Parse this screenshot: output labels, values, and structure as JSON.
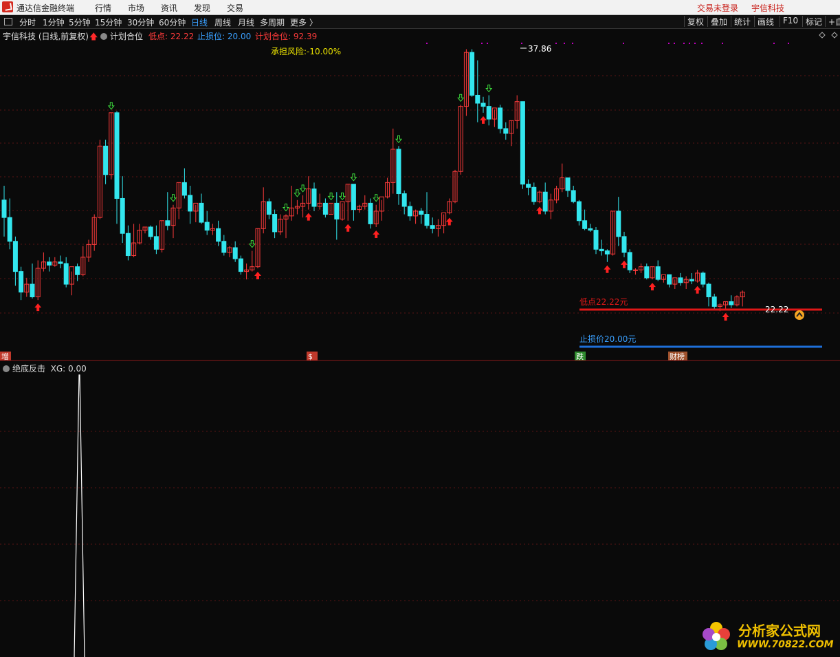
{
  "menubar": {
    "app_title": "通达信金融终端",
    "items": [
      "行情",
      "市场",
      "资讯",
      "发现",
      "交易"
    ],
    "login": "交易未登录",
    "stock_name": "宇信科技"
  },
  "toolbar": {
    "periods": [
      "分时",
      "1分钟",
      "5分钟",
      "15分钟",
      "30分钟",
      "60分钟",
      "日线",
      "周线",
      "月线",
      "多周期",
      "更多 〉"
    ],
    "active_period": "日线",
    "right_buttons": [
      "复权",
      "叠加",
      "统计",
      "画线",
      "F10",
      "标记",
      "+自"
    ]
  },
  "main_info": {
    "stock_title": "宇信科技 (日线,前复权)",
    "indicator": "计划合位",
    "low_point": "低点: 22.22",
    "stop_loss": "止损位: 20.00",
    "plan_position": "计划合位: 92.39",
    "risk": "承担风险:-10.00%"
  },
  "annotations": {
    "high_price": "37.86",
    "low_line_label": "低点22.22元",
    "low_value": "22.22",
    "stop_line_label": "止损价20.00元",
    "bottom_tags": [
      "增",
      "$",
      "跌",
      "财榜"
    ]
  },
  "sub_panel": {
    "title": "绝底反击",
    "value": "XG: 0.00"
  },
  "watermark": {
    "name": "分析家公式网",
    "url": "WWW.70822.COM"
  },
  "colors": {
    "up": "#ff3b3b",
    "down": "#33e6ee",
    "red_line": "#e01818",
    "blue_line": "#1e6fd8",
    "accent_blue": "#3aa0ff",
    "yellow": "#e8e000"
  },
  "chart_data": {
    "type": "candlestick",
    "price_range": [
      19.0,
      38.5
    ],
    "ohlc": [
      [
        28.5,
        29.4,
        26.2,
        27.4
      ],
      [
        27.4,
        28.6,
        25.4,
        25.9
      ],
      [
        25.9,
        26.2,
        23.1,
        24.0
      ],
      [
        24.0,
        24.3,
        22.2,
        22.7
      ],
      [
        22.7,
        23.6,
        22.4,
        23.2
      ],
      [
        23.2,
        24.5,
        22.3,
        22.4
      ],
      [
        22.4,
        24.7,
        22.2,
        24.2
      ],
      [
        24.2,
        25.2,
        24.0,
        24.6
      ],
      [
        24.6,
        24.9,
        24.0,
        24.4
      ],
      [
        24.4,
        24.9,
        24.3,
        24.6
      ],
      [
        24.6,
        25.0,
        24.2,
        24.5
      ],
      [
        24.5,
        24.9,
        23.0,
        23.2
      ],
      [
        23.2,
        24.0,
        22.5,
        24.3
      ],
      [
        24.3,
        24.5,
        23.4,
        23.8
      ],
      [
        23.8,
        25.6,
        23.7,
        24.9
      ],
      [
        24.9,
        26.0,
        24.6,
        25.7
      ],
      [
        25.7,
        27.6,
        25.3,
        27.4
      ],
      [
        27.4,
        32.3,
        27.3,
        31.9
      ],
      [
        31.9,
        32.3,
        29.5,
        30.1
      ],
      [
        30.1,
        34.0,
        29.8,
        34.0
      ],
      [
        34.0,
        34.1,
        27.0,
        28.6
      ],
      [
        28.6,
        30.0,
        25.8,
        26.4
      ],
      [
        26.4,
        26.9,
        24.7,
        25.0
      ],
      [
        25.0,
        27.0,
        24.9,
        25.8
      ],
      [
        25.8,
        27.0,
        25.7,
        26.6
      ],
      [
        26.6,
        26.8,
        26.4,
        26.8
      ],
      [
        26.8,
        26.9,
        26.0,
        26.2
      ],
      [
        26.2,
        26.9,
        25.1,
        25.4
      ],
      [
        25.4,
        27.2,
        25.2,
        27.2
      ],
      [
        27.2,
        29.0,
        26.6,
        26.9
      ],
      [
        26.9,
        28.2,
        26.1,
        28.0
      ],
      [
        28.0,
        29.6,
        27.3,
        29.6
      ],
      [
        29.6,
        30.5,
        28.6,
        28.8
      ],
      [
        28.8,
        29.4,
        27.0,
        27.8
      ],
      [
        27.8,
        28.2,
        27.1,
        28.3
      ],
      [
        28.3,
        28.9,
        27.0,
        27.1
      ],
      [
        27.1,
        27.8,
        26.3,
        26.6
      ],
      [
        26.6,
        27.0,
        26.3,
        26.7
      ],
      [
        26.7,
        27.2,
        25.6,
        25.9
      ],
      [
        25.9,
        26.3,
        25.0,
        25.2
      ],
      [
        25.2,
        25.6,
        24.9,
        25.5
      ],
      [
        25.5,
        25.9,
        24.6,
        24.8
      ],
      [
        24.8,
        25.0,
        23.8,
        24.0
      ],
      [
        24.0,
        24.5,
        23.5,
        24.1
      ],
      [
        24.1,
        25.3,
        24.0,
        24.3
      ],
      [
        24.3,
        26.7,
        24.2,
        26.7
      ],
      [
        26.7,
        29.3,
        26.4,
        28.4
      ],
      [
        28.4,
        28.6,
        27.3,
        27.6
      ],
      [
        27.6,
        27.9,
        26.1,
        26.5
      ],
      [
        26.5,
        27.6,
        26.3,
        27.3
      ],
      [
        27.3,
        27.6,
        26.1,
        27.5
      ],
      [
        27.5,
        29.4,
        27.2,
        28.0
      ],
      [
        28.0,
        28.5,
        27.6,
        28.1
      ],
      [
        28.1,
        28.8,
        27.4,
        28.3
      ],
      [
        28.3,
        30.0,
        27.9,
        29.2
      ],
      [
        29.2,
        29.6,
        27.8,
        28.1
      ],
      [
        28.1,
        28.9,
        27.9,
        28.3
      ],
      [
        28.3,
        28.6,
        27.4,
        27.6
      ],
      [
        27.6,
        28.3,
        27.6,
        28.3
      ],
      [
        28.3,
        29.0,
        26.0,
        27.3
      ],
      [
        27.3,
        28.3,
        27.2,
        28.4
      ],
      [
        28.4,
        29.5,
        27.2,
        29.5
      ],
      [
        29.5,
        29.5,
        27.2,
        27.9
      ],
      [
        27.9,
        28.2,
        27.7,
        28.1
      ],
      [
        28.1,
        28.8,
        27.9,
        28.3
      ],
      [
        28.3,
        28.6,
        26.7,
        27.0
      ],
      [
        27.0,
        28.2,
        26.8,
        27.8
      ],
      [
        27.8,
        28.5,
        27.2,
        28.7
      ],
      [
        28.7,
        29.9,
        28.6,
        29.6
      ],
      [
        29.6,
        33.0,
        28.9,
        31.7
      ],
      [
        31.7,
        31.9,
        28.2,
        28.9
      ],
      [
        28.9,
        29.1,
        27.6,
        28.1
      ],
      [
        28.1,
        28.4,
        27.2,
        27.5
      ],
      [
        27.5,
        27.9,
        27.0,
        27.8
      ],
      [
        27.8,
        28.0,
        27.0,
        27.6
      ],
      [
        27.6,
        29.0,
        26.7,
        26.9
      ],
      [
        26.9,
        27.4,
        26.4,
        26.7
      ],
      [
        26.7,
        27.3,
        26.2,
        26.9
      ],
      [
        26.9,
        27.6,
        26.4,
        27.7
      ],
      [
        27.7,
        28.6,
        27.6,
        28.4
      ],
      [
        28.4,
        30.4,
        28.3,
        30.3
      ],
      [
        30.3,
        34.5,
        30.1,
        34.4
      ],
      [
        34.4,
        38.0,
        33.8,
        37.8
      ],
      [
        37.8,
        38.0,
        35.0,
        35.1
      ],
      [
        35.1,
        37.3,
        33.4,
        34.6
      ],
      [
        34.6,
        35.0,
        34.0,
        34.4
      ],
      [
        34.4,
        35.1,
        33.2,
        33.6
      ],
      [
        33.6,
        34.2,
        33.1,
        34.3
      ],
      [
        34.3,
        34.5,
        32.7,
        33.0
      ],
      [
        33.0,
        33.4,
        32.3,
        32.7
      ],
      [
        32.7,
        33.5,
        31.9,
        33.5
      ],
      [
        33.5,
        35.1,
        33.0,
        34.7
      ],
      [
        34.7,
        34.6,
        29.2,
        29.5
      ],
      [
        29.5,
        29.8,
        28.8,
        29.3
      ],
      [
        29.3,
        29.6,
        28.2,
        28.4
      ],
      [
        28.4,
        29.1,
        28.3,
        29.0
      ],
      [
        29.0,
        29.6,
        27.6,
        27.8
      ],
      [
        27.8,
        28.9,
        27.3,
        28.5
      ],
      [
        28.5,
        29.4,
        28.3,
        29.2
      ],
      [
        29.2,
        30.8,
        29.0,
        29.9
      ],
      [
        29.9,
        29.8,
        28.7,
        29.1
      ],
      [
        29.1,
        29.4,
        28.3,
        28.4
      ],
      [
        28.4,
        28.5,
        26.9,
        27.2
      ],
      [
        27.2,
        27.9,
        26.6,
        26.7
      ],
      [
        26.7,
        27.0,
        26.5,
        26.6
      ],
      [
        26.6,
        26.8,
        25.1,
        25.4
      ],
      [
        25.4,
        26.0,
        25.0,
        25.3
      ],
      [
        25.3,
        25.4,
        24.6,
        25.1
      ],
      [
        25.1,
        27.8,
        25.0,
        27.8
      ],
      [
        27.8,
        28.7,
        25.6,
        26.2
      ],
      [
        26.2,
        26.5,
        24.9,
        25.2
      ],
      [
        25.2,
        25.4,
        23.9,
        24.1
      ],
      [
        24.1,
        24.2,
        23.8,
        24.1
      ],
      [
        24.1,
        24.5,
        23.9,
        24.3
      ],
      [
        24.3,
        24.5,
        23.5,
        23.6
      ],
      [
        23.6,
        24.3,
        23.5,
        24.3
      ],
      [
        24.3,
        24.7,
        23.4,
        23.5
      ],
      [
        23.5,
        23.7,
        23.3,
        23.8
      ],
      [
        23.8,
        23.8,
        23.0,
        23.2
      ],
      [
        23.2,
        23.5,
        22.9,
        23.6
      ],
      [
        23.6,
        23.9,
        23.1,
        23.3
      ],
      [
        23.3,
        23.7,
        22.9,
        23.5
      ],
      [
        23.5,
        23.9,
        23.2,
        23.4
      ],
      [
        23.4,
        24.1,
        23.3,
        23.9
      ],
      [
        23.9,
        24.0,
        23.0,
        23.2
      ],
      [
        23.2,
        23.3,
        21.8,
        22.4
      ],
      [
        22.4,
        22.6,
        21.6,
        21.8
      ],
      [
        21.8,
        22.0,
        21.5,
        21.9
      ],
      [
        21.9,
        22.1,
        21.6,
        22.1
      ],
      [
        22.1,
        22.5,
        21.7,
        21.9
      ],
      [
        21.9,
        22.5,
        21.8,
        22.4
      ],
      [
        22.4,
        22.8,
        21.8,
        22.7
      ]
    ],
    "up_arrows": [
      6,
      45,
      54,
      61,
      66,
      79,
      85,
      95,
      107,
      110,
      115,
      123,
      128,
      140
    ],
    "down_arrows": [
      19,
      30,
      44,
      50,
      52,
      53,
      58,
      60,
      62,
      66,
      70,
      81,
      86
    ],
    "low_line": 22.22,
    "stop_line": 20.0
  }
}
